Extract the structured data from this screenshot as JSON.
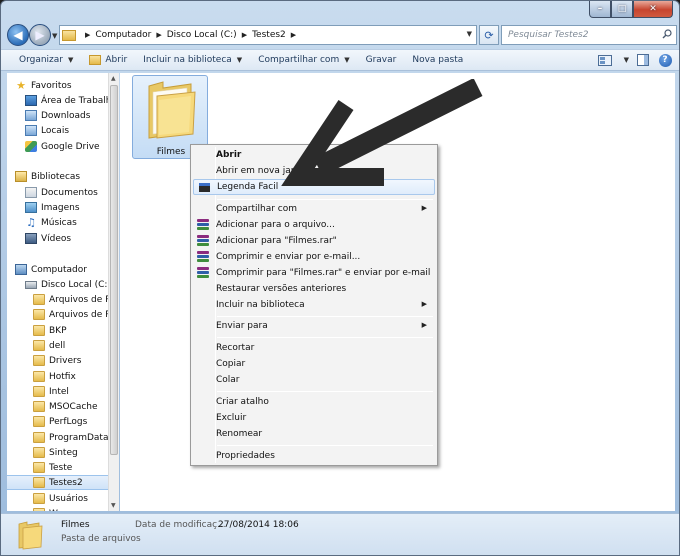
{
  "address": {
    "crumbs": [
      "Computador",
      "Disco Local (C:)",
      "Testes2"
    ],
    "search_placeholder": "Pesquisar Testes2"
  },
  "toolbar": {
    "organize": "Organizar",
    "open": "Abrir",
    "include": "Incluir na biblioteca",
    "share": "Compartilhar com",
    "burn": "Gravar",
    "new_folder": "Nova pasta"
  },
  "nav": {
    "favorites": "Favoritos",
    "desktop": "Área de Trabalho",
    "downloads": "Downloads",
    "places": "Locais",
    "gdrive": "Google Drive",
    "libraries": "Bibliotecas",
    "documents": "Documentos",
    "images": "Imagens",
    "music": "Músicas",
    "videos": "Vídeos",
    "computer": "Computador",
    "local_disk": "Disco Local (C:)",
    "folders": [
      "Arquivos de Pr",
      "Arquivos de Pr",
      "BKP",
      "dell",
      "Drivers",
      "Hotfix",
      "Intel",
      "MSOCache",
      "PerfLogs",
      "ProgramData",
      "Sinteg",
      "Teste",
      "Testes2",
      "Usuários",
      "W"
    ]
  },
  "file": {
    "name": "Filmes"
  },
  "context_menu": {
    "items": [
      "Abrir",
      "Abrir em nova janela",
      "Legenda Facil",
      "Compartilhar com",
      "Adicionar para o arquivo...",
      "Adicionar para \"Filmes.rar\"",
      "Comprimir e enviar por e-mail...",
      "Comprimir para \"Filmes.rar\" e enviar por e-mail",
      "Restaurar versões anteriores",
      "Incluir na biblioteca",
      "Enviar para",
      "Recortar",
      "Copiar",
      "Colar",
      "Criar atalho",
      "Excluir",
      "Renomear",
      "Propriedades"
    ]
  },
  "details": {
    "name": "Filmes",
    "type": "Pasta de arquivos",
    "date_label": "Data de modificaç...",
    "date_value": "27/08/2014 18:06"
  },
  "colors": {
    "accent": "#3b6fc8",
    "annotation_arrow": "#2b2b2b"
  }
}
